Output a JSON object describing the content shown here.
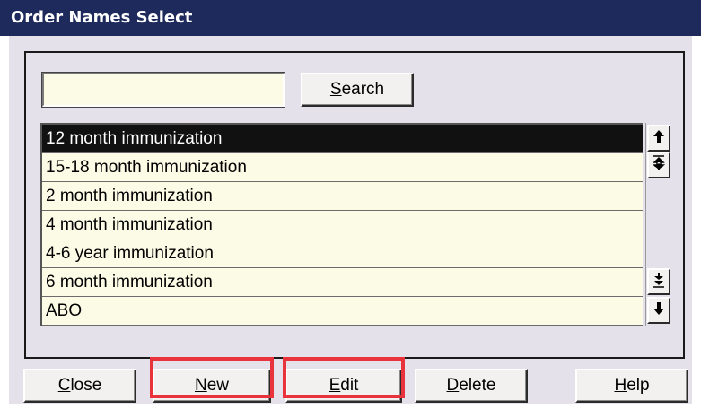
{
  "window": {
    "title": "Order Names Select"
  },
  "search": {
    "value": "",
    "button_prefix": "",
    "button_underline": "S",
    "button_rest": "earch"
  },
  "list": {
    "items": [
      {
        "label": "12 month immunization",
        "selected": true
      },
      {
        "label": "15-18 month immunization",
        "selected": false
      },
      {
        "label": "2 month immunization",
        "selected": false
      },
      {
        "label": "4 month immunization",
        "selected": false
      },
      {
        "label": "4-6 year immunization",
        "selected": false
      },
      {
        "label": "6 month immunization",
        "selected": false
      },
      {
        "label": "ABO",
        "selected": false
      }
    ]
  },
  "scrollbar": {
    "up_glyph": "🠉",
    "page_up_glyph": "⇞",
    "page_down_glyph": "⇟",
    "down_glyph": "🠋"
  },
  "buttons": {
    "close": {
      "underline": "C",
      "rest": "lose"
    },
    "new": {
      "underline": "N",
      "rest": "ew"
    },
    "edit": {
      "underline": "E",
      "rest": "dit"
    },
    "delete": {
      "underline": "D",
      "rest": "elete"
    },
    "help": {
      "underline": "H",
      "rest": "elp"
    }
  },
  "colors": {
    "titlebar": "#1f2a5c",
    "window_bg": "#e5e1ea",
    "list_bg": "#fcfbe6",
    "selected_bg": "#111111",
    "highlight": "#e8323c"
  }
}
